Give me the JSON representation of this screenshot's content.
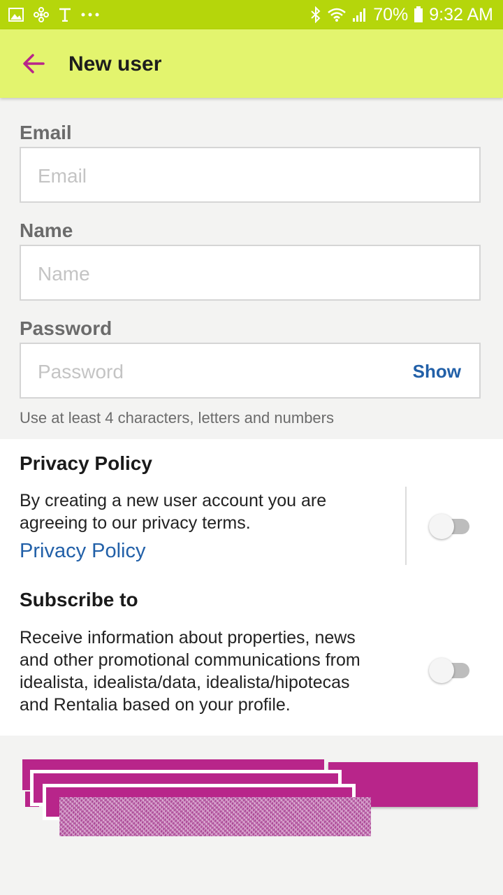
{
  "status_bar": {
    "battery": "70%",
    "time": "9:32 AM",
    "icons": [
      "gallery-icon",
      "fan-icon",
      "t-icon",
      "more-icon",
      "bluetooth-icon",
      "wifi-icon",
      "signal-icon",
      "battery-icon"
    ]
  },
  "toolbar": {
    "title": "New user",
    "accent_color": "#b8258a",
    "background": "#e3f46e"
  },
  "form": {
    "email": {
      "label": "Email",
      "placeholder": "Email",
      "value": ""
    },
    "name": {
      "label": "Name",
      "placeholder": "Name",
      "value": ""
    },
    "password": {
      "label": "Password",
      "placeholder": "Password",
      "value": "",
      "show_label": "Show",
      "hint": "Use at least 4 characters, letters and numbers"
    }
  },
  "privacy": {
    "title": "Privacy Policy",
    "text_line1": "By creating a new user account you are",
    "text_line2": "agreeing to our privacy terms.",
    "link": "Privacy Policy",
    "toggle_on": false
  },
  "subscribe": {
    "title": "Subscribe to",
    "text_line1": "Receive information about properties, news",
    "text_line2": "and other promotional communications from",
    "text_line3": "idealista, idealista/data, idealista/hipotecas",
    "text_line4": "and Rentalia based on your profile.",
    "toggle_on": false
  },
  "colors": {
    "status_bar": "#b5d60b",
    "link": "#2260a8",
    "button": "#b8258a"
  }
}
